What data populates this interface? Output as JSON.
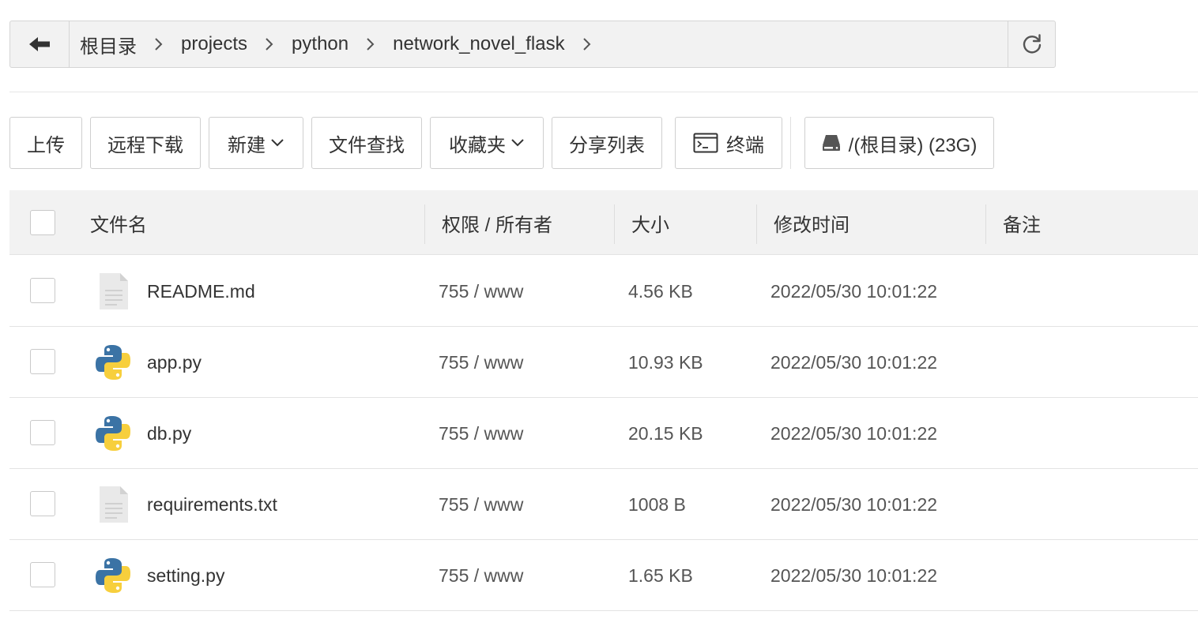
{
  "pathbar": {
    "crumbs": [
      "根目录",
      "projects",
      "python",
      "network_novel_flask"
    ]
  },
  "toolbar": {
    "upload": "上传",
    "remote_download": "远程下载",
    "new": "新建",
    "file_search": "文件查找",
    "favorites": "收藏夹",
    "share_list": "分享列表",
    "terminal": "终端",
    "disk": "/(根目录) (23G)"
  },
  "table": {
    "headers": {
      "name": "文件名",
      "permission": "权限 / 所有者",
      "size": "大小",
      "modified": "修改时间",
      "note": "备注"
    },
    "rows": [
      {
        "icon": "text-file-icon",
        "name": "README.md",
        "perm": "755 / www",
        "size": "4.56 KB",
        "modified": "2022/05/30 10:01:22",
        "note": ""
      },
      {
        "icon": "python-file-icon",
        "name": "app.py",
        "perm": "755 / www",
        "size": "10.93 KB",
        "modified": "2022/05/30 10:01:22",
        "note": ""
      },
      {
        "icon": "python-file-icon",
        "name": "db.py",
        "perm": "755 / www",
        "size": "20.15 KB",
        "modified": "2022/05/30 10:01:22",
        "note": ""
      },
      {
        "icon": "text-file-icon",
        "name": "requirements.txt",
        "perm": "755 / www",
        "size": "1008 B",
        "modified": "2022/05/30 10:01:22",
        "note": ""
      },
      {
        "icon": "python-file-icon",
        "name": "setting.py",
        "perm": "755 / www",
        "size": "1.65 KB",
        "modified": "2022/05/30 10:01:22",
        "note": ""
      }
    ]
  },
  "colors": {
    "python_blue": "#3b73a5",
    "python_yellow": "#f7cf3d",
    "text_file": "#e6e6e6"
  }
}
